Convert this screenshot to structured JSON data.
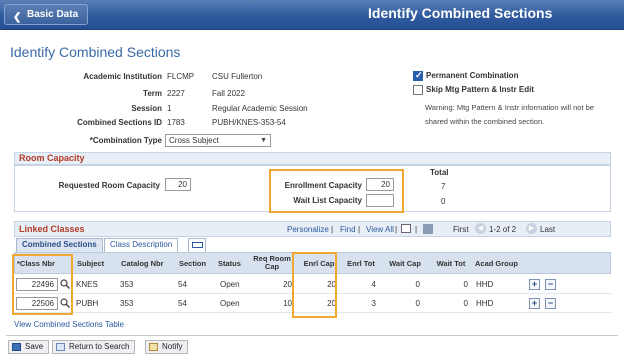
{
  "header": {
    "back_label": "Basic Data",
    "title": "Identify Combined Sections"
  },
  "page_title": "Identify Combined Sections",
  "info": {
    "institution_label": "Academic Institution",
    "institution_code": "FLCMP",
    "institution_name": "CSU Fullerton",
    "term_label": "Term",
    "term_code": "2227",
    "term_name": "Fall 2022",
    "session_label": "Session",
    "session_code": "1",
    "session_name": "Regular Academic Session",
    "combined_id_label": "Combined Sections ID",
    "combined_id": "1783",
    "combined_desc": "PUBH/KNES-353-54",
    "combination_type_label": "*Combination Type",
    "combination_type_value": "Cross Subject"
  },
  "options": {
    "permanent_label": "Permanent Combination",
    "permanent_checked": true,
    "skip_label": "Skip Mtg Pattern & Instr Edit",
    "skip_checked": false,
    "warning": "Warning: Mtg Pattern & Instr information will not be shared within the combined section."
  },
  "room_capacity": {
    "title": "Room Capacity",
    "total_label": "Total",
    "requested_label": "Requested Room Capacity",
    "requested_value": "20",
    "enrollment_label": "Enrollment Capacity",
    "enrollment_value": "20",
    "enrollment_total": "7",
    "waitlist_label": "Wait List Capacity",
    "waitlist_value": "",
    "waitlist_total": "0"
  },
  "linked": {
    "title": "Linked Classes",
    "personalize": "Personalize",
    "find": "Find",
    "view_all": "View All",
    "first": "First",
    "range": "1-2 of 2",
    "last": "Last",
    "tabs": [
      "Combined Sections",
      "Class Description"
    ],
    "columns": [
      "*Class Nbr",
      "Subject",
      "Catalog Nbr",
      "Section",
      "Status",
      "Req Room Cap",
      "Enrl Cap",
      "Enrl Tot",
      "Wait Cap",
      "Wait Tot",
      "Acad Group"
    ],
    "rows": [
      {
        "class_nbr": "22496",
        "subject": "KNES",
        "catalog": "353",
        "section": "54",
        "status": "Open",
        "req_cap": "20",
        "enrl_cap": "20",
        "enrl_tot": "4",
        "wait_cap": "0",
        "wait_tot": "0",
        "acad_group": "HHD"
      },
      {
        "class_nbr": "22506",
        "subject": "PUBH",
        "catalog": "353",
        "section": "54",
        "status": "Open",
        "req_cap": "10",
        "enrl_cap": "20",
        "enrl_tot": "3",
        "wait_cap": "0",
        "wait_tot": "0",
        "acad_group": "HHD"
      }
    ]
  },
  "view_table_link": "View Combined Sections Table",
  "footer": {
    "save": "Save",
    "return": "Return to Search",
    "notify": "Notify"
  },
  "colors": {
    "header_blue": "#2f5b9e",
    "group_title": "#b13b25",
    "highlight": "#f0a830",
    "link": "#2b5aa0"
  }
}
